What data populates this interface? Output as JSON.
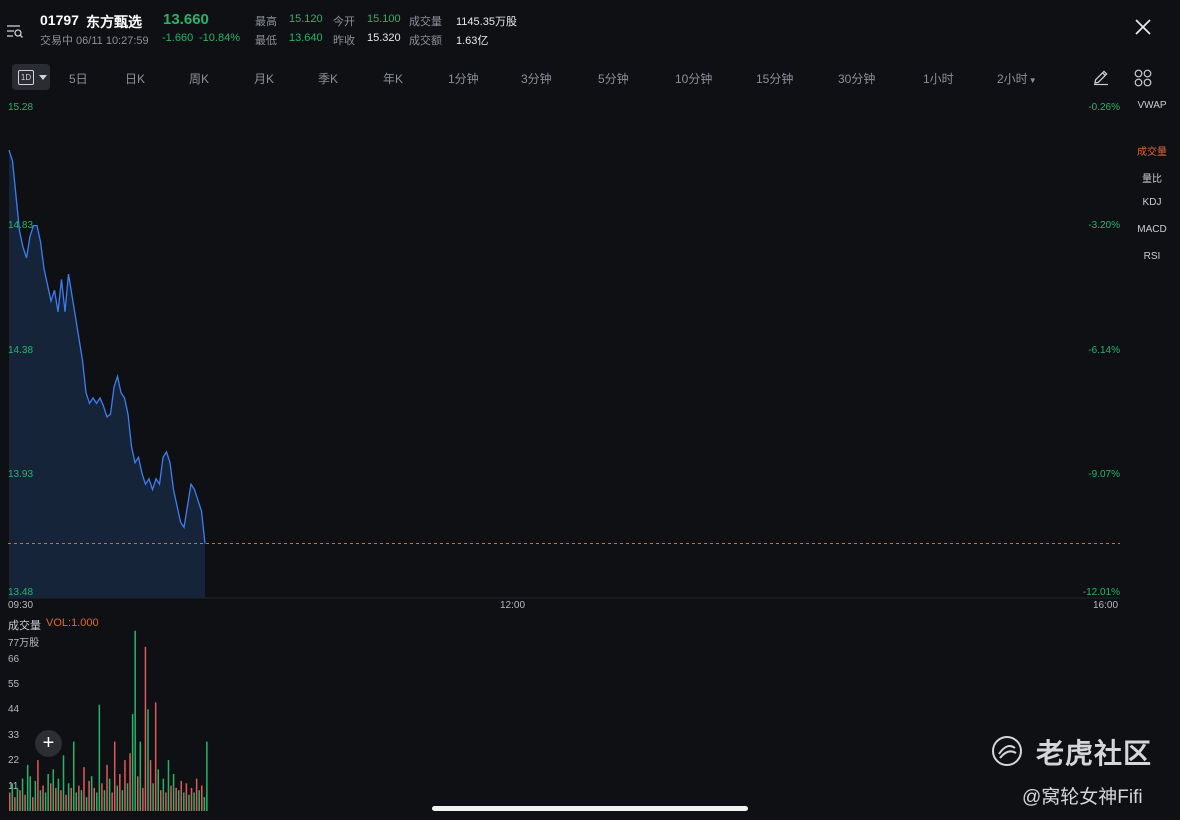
{
  "header": {
    "code": "01797",
    "name": "东方甄选",
    "price": "13.660",
    "status": "交易中 06/11 10:27:59",
    "change": "-1.660",
    "change_pct": "-10.84%",
    "stats": {
      "high_label": "最高",
      "high": "15.120",
      "open_label": "今开",
      "open": "15.100",
      "volume_label": "成交量",
      "volume": "1145.35万股",
      "low_label": "最低",
      "low": "13.640",
      "prev_close_label": "昨收",
      "prev_close": "15.320",
      "turnover_label": "成交额",
      "turnover": "1.63亿"
    }
  },
  "tabs": {
    "active": "1D",
    "items": [
      "5日",
      "日K",
      "周K",
      "月K",
      "季K",
      "年K",
      "1分钟",
      "3分钟",
      "5分钟",
      "10分钟",
      "15分钟",
      "30分钟",
      "1小时",
      "2小时"
    ]
  },
  "indicators": [
    "VWAP",
    "成交量",
    "量比",
    "KDJ",
    "MACD",
    "RSI"
  ],
  "chart_data": [
    {
      "type": "line",
      "y_labels": [
        "15.28",
        "14.83",
        "14.38",
        "13.93",
        "13.48"
      ],
      "pct_labels": [
        "-0.26%",
        "-3.20%",
        "-6.14%",
        "-9.07%",
        "-12.01%"
      ],
      "x_labels": [
        "09:30",
        "12:00",
        "16:00"
      ],
      "ylim": [
        13.48,
        15.28
      ],
      "current_price_line": 13.66,
      "series": [
        {
          "values": [
            15.12,
            15.08,
            14.95,
            14.82,
            14.76,
            14.72,
            14.8,
            14.84,
            14.84,
            14.78,
            14.68,
            14.62,
            14.56,
            14.6,
            14.52,
            14.64,
            14.52,
            14.66,
            14.58,
            14.5,
            14.42,
            14.34,
            14.22,
            14.18,
            14.2,
            14.18,
            14.2,
            14.17,
            14.13,
            14.14,
            14.24,
            14.28,
            14.22,
            14.2,
            14.14,
            14.02,
            13.96,
            13.98,
            13.92,
            13.88,
            13.9,
            13.86,
            13.9,
            13.88,
            13.98,
            14.0,
            13.96,
            13.86,
            13.8,
            13.74,
            13.72,
            13.8,
            13.88,
            13.86,
            13.82,
            13.78,
            13.66
          ]
        }
      ]
    },
    {
      "type": "bar",
      "title": "成交量",
      "params": "VOL:1.000",
      "unit": "77万股",
      "y_labels": [
        "66",
        "55",
        "44",
        "33",
        "22",
        "11"
      ],
      "ylim": [
        0,
        77
      ],
      "values": [
        8,
        12,
        6,
        10,
        9,
        14,
        7,
        20,
        15,
        6,
        13,
        22,
        9,
        11,
        8,
        16,
        12,
        18,
        10,
        14,
        9,
        24,
        7,
        12,
        10,
        30,
        8,
        11,
        9,
        19,
        6,
        13,
        15,
        10,
        8,
        46,
        12,
        9,
        20,
        14,
        8,
        30,
        11,
        16,
        9,
        22,
        12,
        25,
        42,
        78,
        15,
        30,
        10,
        71,
        44,
        22,
        12,
        47,
        18,
        9,
        14,
        8,
        22,
        11,
        16,
        10,
        9,
        13,
        8,
        12,
        7,
        10,
        8,
        14,
        9,
        11,
        6,
        30
      ],
      "colors": [
        "#e05a5a",
        "#27b36b",
        "#e05a5a",
        "#27b36b",
        "#e05a5a",
        "#27b36b",
        "#e05a5a",
        "#27b36b",
        "#27b36b",
        "#e05a5a",
        "#27b36b",
        "#e05a5a",
        "#27b36b",
        "#e05a5a",
        "#27b36b",
        "#27b36b",
        "#e05a5a",
        "#27b36b",
        "#e05a5a",
        "#27b36b",
        "#e05a5a",
        "#27b36b",
        "#e05a5a",
        "#27b36b",
        "#e05a5a",
        "#27b36b",
        "#27b36b",
        "#e05a5a",
        "#27b36b",
        "#e05a5a",
        "#27b36b",
        "#e05a5a",
        "#27b36b",
        "#e05a5a",
        "#27b36b",
        "#27b36b",
        "#e05a5a",
        "#27b36b",
        "#e05a5a",
        "#27b36b",
        "#e05a5a",
        "#e05a5a",
        "#27b36b",
        "#e05a5a",
        "#27b36b",
        "#e05a5a",
        "#27b36b",
        "#e05a5a",
        "#27b36b",
        "#27b36b",
        "#e05a5a",
        "#27b36b",
        "#e05a5a",
        "#e05a5a",
        "#27b36b",
        "#e05a5a",
        "#27b36b",
        "#e05a5a",
        "#27b36b",
        "#e05a5a",
        "#27b36b",
        "#e05a5a",
        "#27b36b",
        "#e05a5a",
        "#27b36b",
        "#e05a5a",
        "#27b36b",
        "#e05a5a",
        "#27b36b",
        "#e05a5a",
        "#27b36b",
        "#e05a5a",
        "#27b36b",
        "#e05a5a",
        "#27b36b",
        "#e05a5a",
        "#27b36b",
        "#27b36b"
      ]
    }
  ],
  "watermark": {
    "brand": "老虎社区",
    "author": "@窝轮女神Fifi"
  },
  "icons": {
    "menu": "list-search-icon",
    "close": "close-icon",
    "draw": "pencil-icon",
    "layout": "grid-icon",
    "add": "plus-icon"
  }
}
